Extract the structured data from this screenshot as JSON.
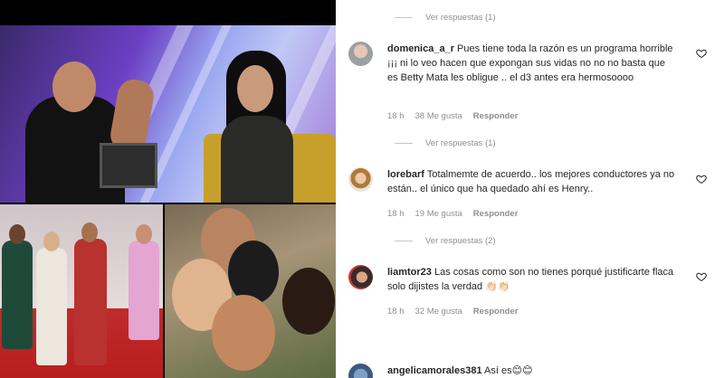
{
  "replies_label_1": "Ver respuestas (1)",
  "comments": [
    {
      "username": "domenica_a_r",
      "text": "Pues tiene toda la razón es un programa horrible ¡¡¡ ni lo veo hacen que expongan sus vidas no no no basta que es Betty Mata les obligue .. el d3 antes era hermosoooo",
      "time": "18 h",
      "likes": "38 Me gusta",
      "reply": "Responder",
      "view_replies": "Ver respuestas (1)"
    },
    {
      "username": "lorebarf",
      "text": "Totalmemte de acuerdo.. los mejores conductores ya no están.. el único que ha quedado ahí es Henry..",
      "time": "18 h",
      "likes": "19 Me gusta",
      "reply": "Responder",
      "view_replies": "Ver respuestas (2)"
    },
    {
      "username": "liamtor23",
      "text": "Las cosas como son no tienes porqué justificarte flaca solo dijistes la verdad 👏🏻👏🏻",
      "time": "18 h",
      "likes": "32 Me gusta",
      "reply": "Responder",
      "view_replies": ""
    },
    {
      "username": "angelicamorales381",
      "text": "Así es😊😊",
      "time": "",
      "likes": "",
      "reply": "",
      "view_replies": ""
    }
  ],
  "icons": {
    "like": "heart-icon"
  },
  "colors": {
    "secondary_text": "#8e8e8e",
    "primary_text": "#262626"
  }
}
